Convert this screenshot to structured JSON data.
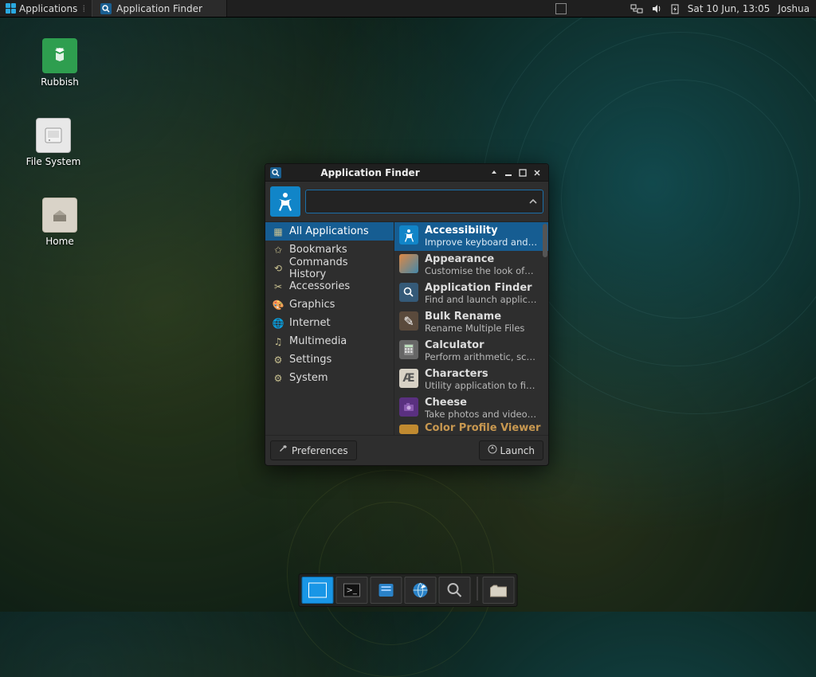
{
  "panel": {
    "applications_label": "Applications",
    "task_label": "Application Finder",
    "datetime": "Sat 10 Jun, 13:05",
    "user": "Joshua"
  },
  "desktop": {
    "rubbish": "Rubbish",
    "filesystem": "File System",
    "home": "Home"
  },
  "window": {
    "title": "Application Finder",
    "search_value": "",
    "categories": [
      {
        "label": "All Applications",
        "icon": "grid"
      },
      {
        "label": "Bookmarks",
        "icon": "star"
      },
      {
        "label": "Commands History",
        "icon": "history"
      },
      {
        "label": "Accessories",
        "icon": "tools"
      },
      {
        "label": "Graphics",
        "icon": "palette"
      },
      {
        "label": "Internet",
        "icon": "globe"
      },
      {
        "label": "Multimedia",
        "icon": "media"
      },
      {
        "label": "Settings",
        "icon": "sliders"
      },
      {
        "label": "System",
        "icon": "gear"
      }
    ],
    "selected_category": 0,
    "apps": [
      {
        "title": "Accessibility",
        "desc": "Improve keyboard and…",
        "color": "#1185c8"
      },
      {
        "title": "Appearance",
        "desc": "Customise the look of…",
        "color": "#c06028"
      },
      {
        "title": "Application Finder",
        "desc": "Find and launch applic…",
        "color": "#4a7aa8"
      },
      {
        "title": "Bulk Rename",
        "desc": "Rename Multiple Files",
        "color": "#6a5a48"
      },
      {
        "title": "Calculator",
        "desc": "Perform arithmetic, sc…",
        "color": "#777"
      },
      {
        "title": "Characters",
        "desc": "Utility application to fi…",
        "color": "#a8a296"
      },
      {
        "title": "Cheese",
        "desc": "Take photos and video…",
        "color": "#6a3a90"
      },
      {
        "title": "Color Profile Viewer",
        "desc": "",
        "color": "#c08a30"
      }
    ],
    "selected_app": 0,
    "preferences_label": "Preferences",
    "launch_label": "Launch"
  }
}
